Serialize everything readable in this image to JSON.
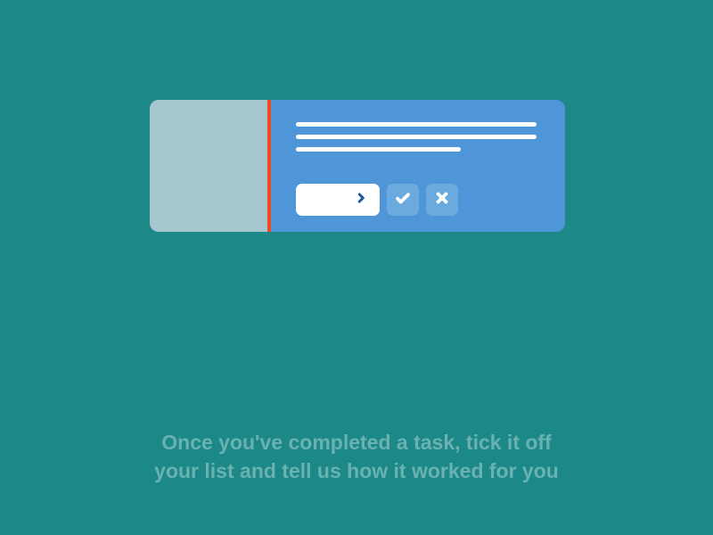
{
  "caption": {
    "line1": "Once you've completed a task, tick it off",
    "line2": "your list and tell us how it worked for you"
  }
}
